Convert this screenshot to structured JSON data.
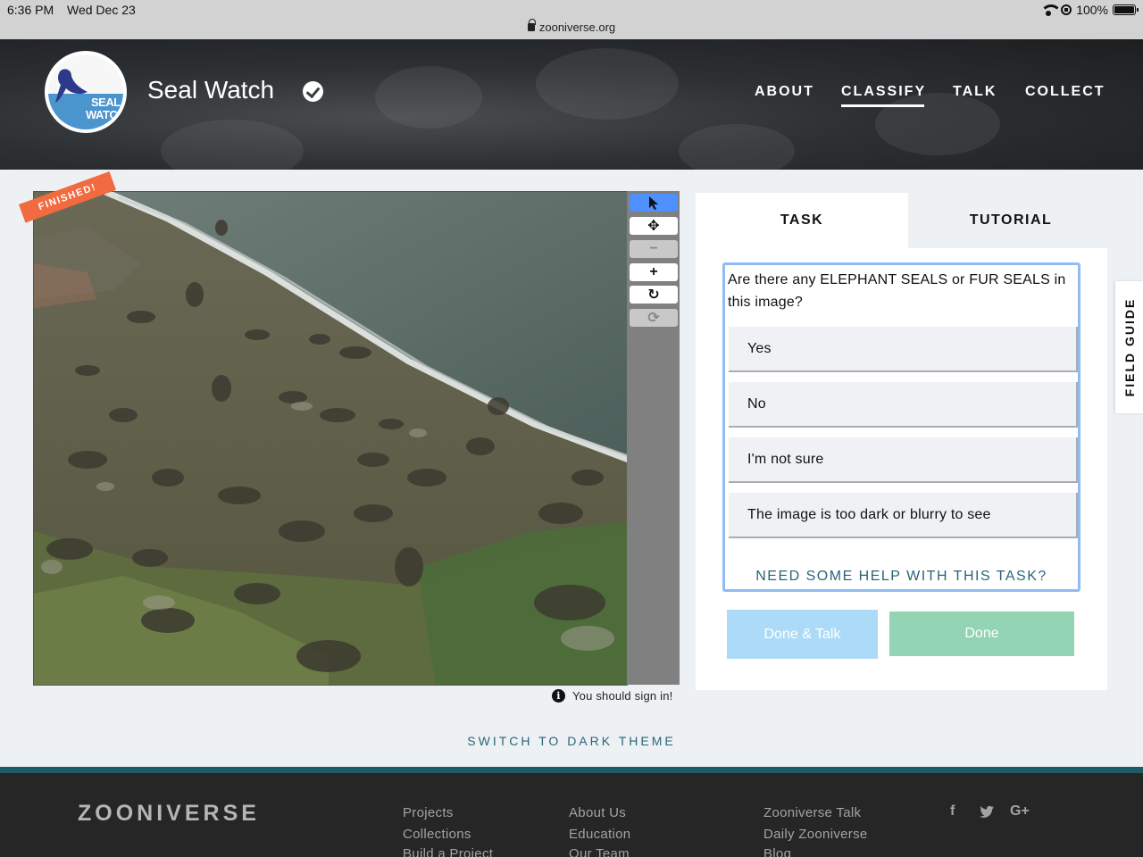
{
  "status_bar": {
    "time": "6:36 PM",
    "date": "Wed Dec 23",
    "url": "zooniverse.org",
    "battery": "100%",
    "battery_level": 1.0
  },
  "header": {
    "logo_line1": "SEAL",
    "logo_line2": "WATCH",
    "project_title": "Seal Watch",
    "nav": [
      {
        "label": "ABOUT"
      },
      {
        "label": "CLASSIFY",
        "active": true
      },
      {
        "label": "TALK"
      },
      {
        "label": "COLLECT"
      }
    ]
  },
  "subject": {
    "badge": "FINISHED!",
    "sign_in_note": "You should sign in!"
  },
  "toolbar": {
    "tools": [
      {
        "icon": "pointer-icon",
        "glyph": "➤",
        "selected": true
      },
      {
        "icon": "move-icon",
        "glyph": "✥"
      },
      {
        "icon": "zoom-out-icon",
        "glyph": "−",
        "disabled": true
      },
      {
        "icon": "zoom-in-icon",
        "glyph": "+"
      },
      {
        "icon": "rotate-icon",
        "glyph": "↻"
      },
      {
        "icon": "reset-icon",
        "glyph": "⟳",
        "disabled": true
      }
    ]
  },
  "task_panel": {
    "tab_task": "TASK",
    "tab_tutorial": "TUTORIAL",
    "question": "Are there any ELEPHANT SEALS or FUR SEALS in this image?",
    "answers": [
      "Yes",
      "No",
      "I'm not sure",
      "The image is too dark or blurry to see"
    ],
    "help": "NEED SOME HELP WITH THIS TASK?",
    "done_talk": "Done & Talk",
    "done": "Done"
  },
  "field_guide": "FIELD GUIDE",
  "theme_switch": "SWITCH TO DARK THEME",
  "footer": {
    "logo": "ZOONIVERSE",
    "col1": [
      "Projects",
      "Collections",
      "Build a Project"
    ],
    "col2": [
      "About Us",
      "Education",
      "Our Team"
    ],
    "col3": [
      "Zooniverse Talk",
      "Daily Zooniverse",
      "Blog"
    ],
    "social": [
      "f",
      "G+"
    ]
  },
  "colors": {
    "accent": "#2a6478",
    "finished_badge": "#f26a3f",
    "selected_outline": "#8fbcf4",
    "done_talk": "#addbf7",
    "done": "#93d4b4"
  }
}
